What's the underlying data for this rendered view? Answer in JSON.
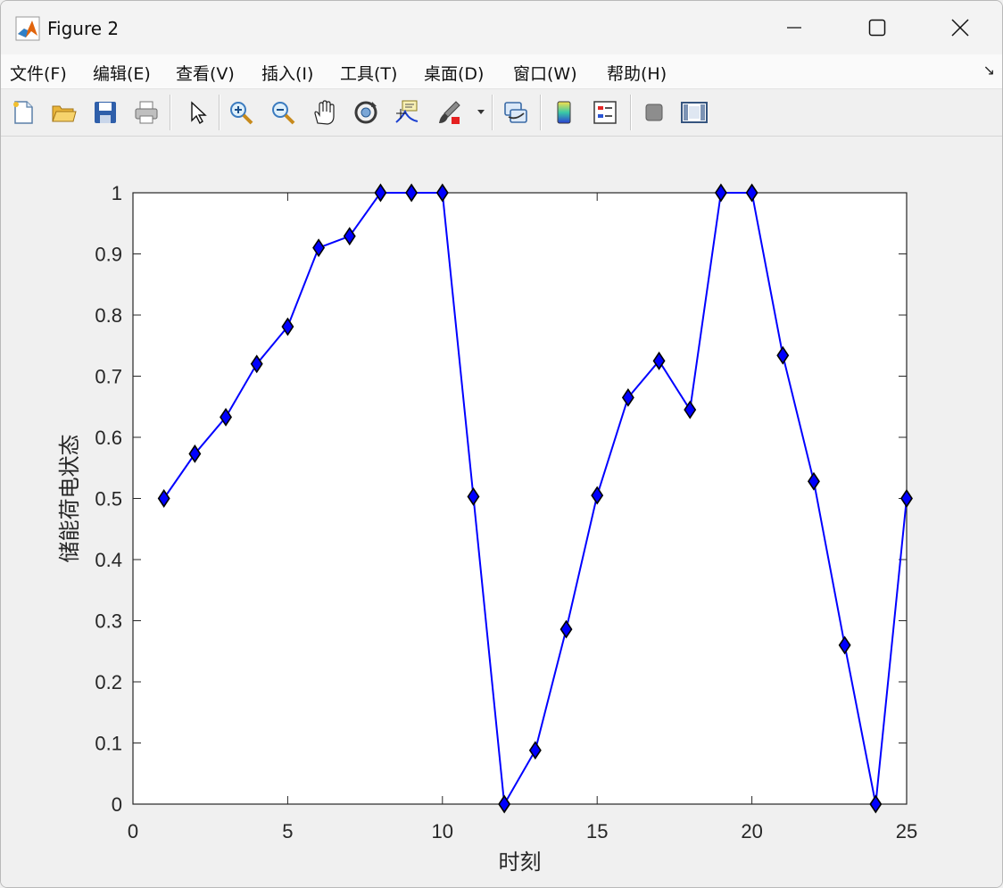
{
  "window": {
    "title": "Figure 2",
    "controls": [
      "minimize",
      "maximize",
      "close"
    ]
  },
  "menubar": {
    "items": [
      {
        "label": "文件(F)"
      },
      {
        "label": "编辑(E)"
      },
      {
        "label": "查看(V)"
      },
      {
        "label": "插入(I)"
      },
      {
        "label": "工具(T)"
      },
      {
        "label": "桌面(D)"
      },
      {
        "label": "窗口(W)"
      },
      {
        "label": "帮助(H)"
      }
    ],
    "dock_arrow": "↘"
  },
  "toolbar": {
    "icons": [
      "new-figure-icon",
      "open-file-icon",
      "save-icon",
      "print-icon",
      "edit-plot-arrow-icon",
      "zoom-in-icon",
      "zoom-out-icon",
      "pan-hand-icon",
      "rotate-3d-icon",
      "data-cursor-icon",
      "brush-icon",
      "brush-dropdown-icon",
      "link-plot-icon",
      "colorbar-icon",
      "legend-icon",
      "hide-plot-tools-icon",
      "show-plot-tools-icon"
    ]
  },
  "chart_data": {
    "type": "line",
    "title": "",
    "xlabel": "时刻",
    "ylabel": "储能荷电状态",
    "xlim": [
      0,
      25
    ],
    "ylim": [
      0,
      1
    ],
    "xticks": [
      0,
      5,
      10,
      15,
      20,
      25
    ],
    "yticks": [
      0,
      0.1,
      0.2,
      0.3,
      0.4,
      0.5,
      0.6,
      0.7,
      0.8,
      0.9,
      1
    ],
    "grid": false,
    "legend": "none",
    "series": [
      {
        "color": "#0000ff",
        "marker": "diamond",
        "marker_face": "#0000ff",
        "marker_edge": "#000000",
        "x": [
          1,
          2,
          3,
          4,
          5,
          6,
          7,
          8,
          9,
          10,
          11,
          12,
          13,
          14,
          15,
          16,
          17,
          18,
          19,
          20,
          21,
          22,
          23,
          24,
          25
        ],
        "y": [
          0.5,
          0.573,
          0.633,
          0.72,
          0.781,
          0.91,
          0.929,
          1,
          1,
          1,
          0.503,
          0,
          0.088,
          0.286,
          0.505,
          0.665,
          0.725,
          0.645,
          1,
          1,
          0.734,
          0.528,
          0.26,
          0,
          0.5
        ]
      }
    ]
  }
}
